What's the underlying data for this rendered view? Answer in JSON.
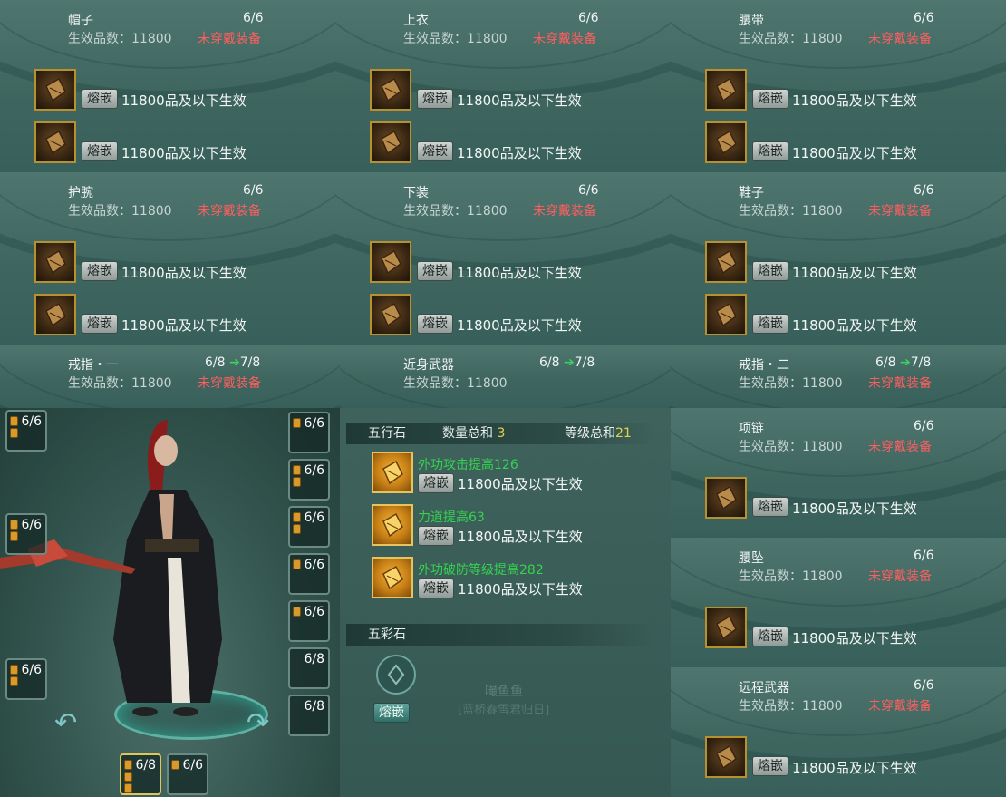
{
  "common": {
    "eff_label": "生效品数：11800",
    "warn": "未穿戴装备",
    "inlay": "熔嵌",
    "slot_text": "11800品及以下生效",
    "arrow": "➔"
  },
  "panels": [
    {
      "title": "帽子",
      "count": "6/6"
    },
    {
      "title": "上衣",
      "count": "6/6"
    },
    {
      "title": "腰带",
      "count": "6/6"
    },
    {
      "title": "护腕",
      "count": "6/6"
    },
    {
      "title": "下装",
      "count": "6/6"
    },
    {
      "title": "鞋子",
      "count": "6/6"
    },
    {
      "title": "戒指・一",
      "count": "6/8",
      "next": "7/8"
    },
    {
      "title": "近身武器",
      "count": "6/8",
      "next": "7/8"
    },
    {
      "title": "戒指・二",
      "count": "6/8",
      "next": "7/8"
    },
    {
      "title": "项链",
      "count": "6/6"
    },
    {
      "title": "腰坠",
      "count": "6/6"
    },
    {
      "title": "远程武器",
      "count": "6/6"
    }
  ],
  "weapon": {
    "wuxing_title": "五行石",
    "count_label": "数量总和",
    "count_value": "3",
    "level_label": "等级总和",
    "level_value": "21",
    "gems": [
      "外功攻击提高126",
      "力道提高63",
      "外功破防等级提高282"
    ],
    "wucai_title": "五彩石",
    "ghost_name": "嘬鱼鱼",
    "ghost_sub": "[蓝桥春雪君归日]"
  },
  "char_slots": {
    "left": [
      "6/6",
      "6/6",
      "6/6"
    ],
    "right": [
      "6/6",
      "6/6",
      "6/6",
      "6/6",
      "6/6",
      "6/8",
      "6/8"
    ],
    "bottom": [
      "6/8",
      "6/6"
    ]
  }
}
